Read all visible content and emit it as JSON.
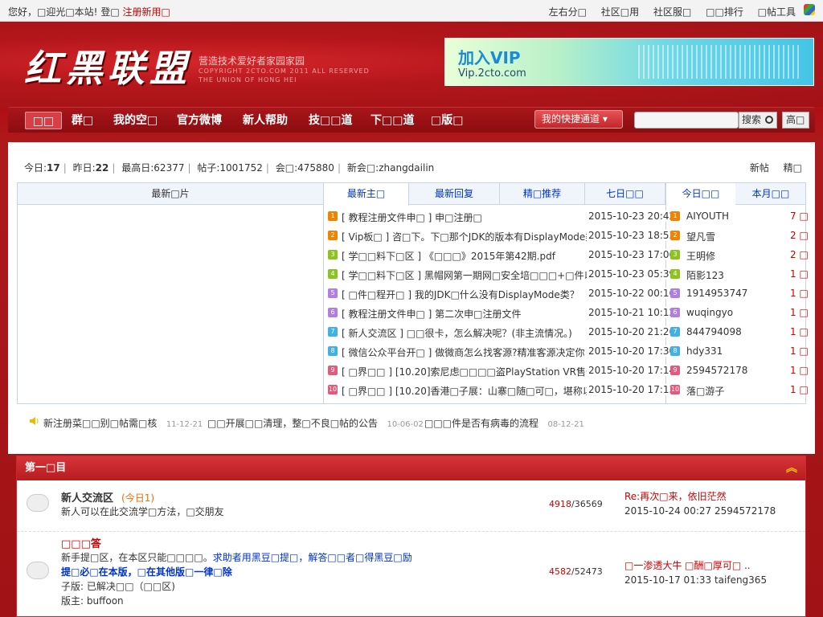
{
  "topbar": {
    "greeting": "您好，□迎光□本站!",
    "login": "登□",
    "register": "注册新用□",
    "links": [
      "左右分□",
      "社区□用",
      "社区服□",
      "□□排行",
      "□帖工具"
    ]
  },
  "header": {
    "logo": "红黑联盟",
    "slogan": "营造技术爱好者家园家园",
    "copyright_line1": "COPYRIGHT 2CTO.COM 2011 ALL RESERVED",
    "copyright_line2": "THE UNION OF HONG HEI",
    "vip_title": "加入VIP",
    "vip_url": "Vip.2cto.com"
  },
  "nav": {
    "items": [
      "□□",
      "群□",
      "我的空□",
      "官方微博",
      "新人帮助",
      "技□□道",
      "下□□道",
      "□版□"
    ],
    "quick_label": "我的快捷通道",
    "search_btn": "搜索",
    "adv_btn": "高□",
    "search_placeholder": ""
  },
  "stats": {
    "today_label": "今日:",
    "today": "17",
    "yesterday_label": "昨日:",
    "yesterday": "22",
    "max_label": "最高日:",
    "max": "62377",
    "posts_label": "帖子:",
    "posts": "1001752",
    "members_label": "会□:",
    "members": "475880",
    "newest_label": "新会□:",
    "newest": "zhangdailin",
    "new_posts": "新帖",
    "digest": "精□"
  },
  "portal": {
    "pic_header": "最新□片",
    "tabs": [
      "最新主□",
      "最新回复",
      "精□推荐",
      "七日□□"
    ],
    "rtabs": [
      "今日□□",
      "本月□□"
    ],
    "threads": [
      {
        "n": "1",
        "title": "[ 教程注册文件申□ ] 申□注册□",
        "date": "2015-10-23 20:42",
        "user": "AIYOUTH",
        "cnt": "7 □"
      },
      {
        "n": "2",
        "title": "[ Vip板□ ] 咨□下。下□那个JDK的版本有DisplayMode类",
        "date": "2015-10-23 18:53",
        "user": "望凡雪",
        "cnt": "2 □"
      },
      {
        "n": "3",
        "title": "[ 学□□料下□区 ] 《□□□》2015年第42期.pdf",
        "date": "2015-10-23 17:06",
        "user": "王明修",
        "cnt": "2 □"
      },
      {
        "n": "4",
        "title": "[ 学□□料下□区 ] 黑帽网第一期网□安全培□□□+□件以及",
        "date": "2015-10-23 05:39",
        "user": "陌影123",
        "cnt": "1 □"
      },
      {
        "n": "5",
        "title": "[ □件□程开□ ] 我的JDK□什么没有DisplayMode类？",
        "date": "2015-10-22 00:16",
        "user": "1914953747",
        "cnt": "1 □"
      },
      {
        "n": "6",
        "title": "[ 教程注册文件申□ ] 第二次申□注册文件",
        "date": "2015-10-21 10:12",
        "user": "wuqingyo",
        "cnt": "1 □"
      },
      {
        "n": "7",
        "title": "[ 新人交流区 ] □□很卡，怎么解决呢？(非主流情况。)",
        "date": "2015-10-20 21:26",
        "user": "844794098",
        "cnt": "1 □"
      },
      {
        "n": "8",
        "title": "[ 微信公众平台开□ ] 做微商怎么找客源?精准客源决定你",
        "date": "2015-10-20 17:30",
        "user": "hdy331",
        "cnt": "1 □"
      },
      {
        "n": "9",
        "title": "[ □界□□ ] [10.20]索尼虑□□□□盗PlayStation VR售价曝",
        "date": "2015-10-20 17:14",
        "user": "2594572178",
        "cnt": "1 □"
      },
      {
        "n": "10",
        "title": "[ □界□□ ] [10.20]香港□子展：山寨□随□可□，堪称以假",
        "date": "2015-10-20 17:13",
        "user": "落□游子",
        "cnt": "1 □"
      }
    ],
    "num_colors": [
      "#f08300",
      "#f08300",
      "#8dc21f",
      "#8dc21f",
      "#b07fe0",
      "#b07fe0",
      "#3fb1e2",
      "#3fb1e2",
      "#e25b7d",
      "#e25b7d"
    ]
  },
  "announcements": [
    {
      "text": "新注册菜□□别□帖需□核",
      "date": "11-12-21"
    },
    {
      "text": "□□开展□□清理，整□不良□帖的公告",
      "date": "10-06-02"
    },
    {
      "text": "□□□件是否有病毒的流程",
      "date": "08-12-21"
    }
  ],
  "category": {
    "title": "第一□目",
    "forums": [
      {
        "name": "新人交流区",
        "today": "(今日1)",
        "desc": "新人可以在此交流学□方法，□交朋友",
        "threads": "4918",
        "posts": "/36569",
        "last_title": "Re:再次□来，依旧茫然",
        "last_info": "2015-10-24 00:27 2594572178"
      },
      {
        "name": "□□□答",
        "desc1": "新手提□区，在本区只能□□□□。",
        "desc1_blue": "求助者用黑豆□提□，解答□□者□得黑豆□励",
        "desc2_blue": "提□必□在本版，□在其他版□一律□除",
        "sub": "子版: 已解决□□（□□区)",
        "mod": "版主: buffoon",
        "threads": "4582",
        "posts": "/52473",
        "last_title": "□一渗透大牛 □酬□厚可□ ..",
        "last_info": "2015-10-17 01:33 taifeng365"
      }
    ]
  }
}
